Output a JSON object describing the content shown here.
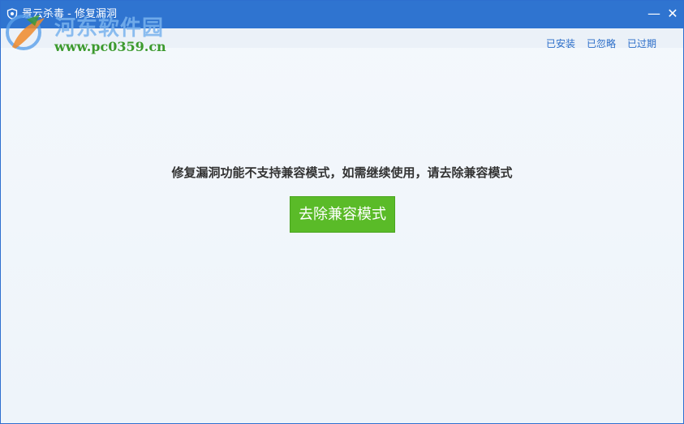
{
  "window": {
    "title": "景云杀毒 - 修复漏洞",
    "minimize_glyph": "—",
    "close_glyph": "✕",
    "app_icon": "shield-icon"
  },
  "watermark": {
    "site_name": "河东软件园",
    "url": "www.pc0359.cn"
  },
  "header_links": {
    "installed": "已安装",
    "ignored": "已忽略",
    "expired": "已过期"
  },
  "main": {
    "message": "修复漏洞功能不支持兼容模式，如需继续使用，请去除兼容模式",
    "button_label": "去除兼容模式"
  },
  "colors": {
    "titlebar": "#2f74d0",
    "link": "#2a6dc8",
    "button": "#5abb28"
  }
}
